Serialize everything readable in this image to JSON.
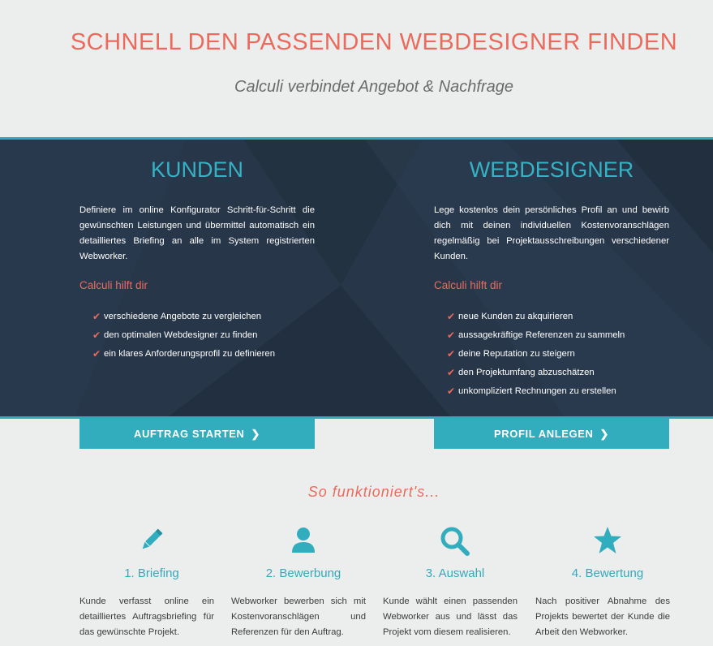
{
  "hero": {
    "title": "SCHNELL DEN PASSENDEN WEBDESIGNER FINDEN",
    "subtitle": "Calculi verbindet Angebot & Nachfrage"
  },
  "colors": {
    "accent": "#31adbd",
    "coral": "#ec6a5c",
    "band": "#273649",
    "background": "#eceeee"
  },
  "kunden": {
    "title": "KUNDEN",
    "text": "Definiere im online Konfigurator Schritt-für-Schritt die gewünschten Leistungen und übermittel automatisch ein detailliertes Briefing an alle im System registrierten Webworker.",
    "subheading": "Calculi hilft dir",
    "items": [
      "verschiedene Angebote zu vergleichen",
      "den optimalen Webdesigner zu finden",
      "ein klares Anforderungsprofil zu definieren"
    ],
    "button": "AUFTRAG STARTEN"
  },
  "webdesigner": {
    "title": "WEBDESIGNER",
    "text": "Lege kostenlos dein persönliches Profil an und bewirb dich mit deinen individuellen Kostenvoranschlägen regelmäßig bei Projektausschreibungen verschiedener Kunden.",
    "subheading": "Calculi hilft dir",
    "items": [
      "neue Kunden zu akquirieren",
      "aussagekräftige Referenzen zu sammeln",
      "deine Reputation zu steigern",
      "den Projektumfang abzuschätzen",
      "unkompliziert Rechnungen zu erstellen"
    ],
    "button": "PROFIL ANLEGEN"
  },
  "how": {
    "title": "So funktioniert's...",
    "steps": [
      {
        "icon": "pencil-icon",
        "title": "1. Briefing",
        "text": "Kunde verfasst online ein detailliertes Auftragsbriefing für das gewünschte Projekt."
      },
      {
        "icon": "user-icon",
        "title": "2. Bewerbung",
        "text": "Webworker bewerben sich mit Kostenvoranschlägen und Referenzen für den Auftrag."
      },
      {
        "icon": "search-icon",
        "title": "3. Auswahl",
        "text": "Kunde wählt einen passenden Webworker aus und lässt das Projekt vom diesem realisieren."
      },
      {
        "icon": "star-icon",
        "title": "4. Bewertung",
        "text": "Nach positiver Abnahme des Projekts bewertet der Kunde die Arbeit den Webworker."
      }
    ]
  }
}
